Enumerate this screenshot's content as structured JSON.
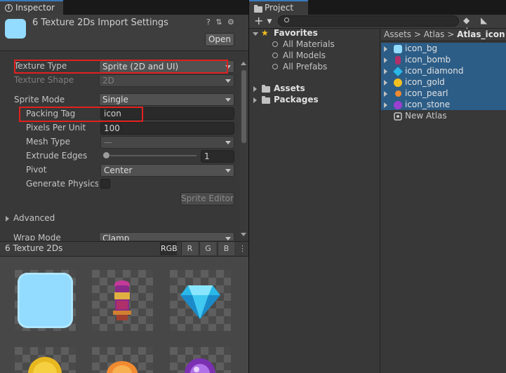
{
  "inspector": {
    "tab_label": "Inspector",
    "tab_tools": "⋮ ≡",
    "title": "6 Texture 2Ds Import Settings",
    "header_tools": "? ⇅ ⚙",
    "open_button": "Open",
    "fields": {
      "texture_type": {
        "label": "Texture Type",
        "value": "Sprite (2D and UI)"
      },
      "texture_shape": {
        "label": "Texture Shape",
        "value": "2D"
      },
      "sprite_mode": {
        "label": "Sprite Mode",
        "value": "Single"
      },
      "packing_tag": {
        "label": "Packing Tag",
        "value": "icon"
      },
      "pixels_per_unit": {
        "label": "Pixels Per Unit",
        "value": "100"
      },
      "mesh_type": {
        "label": "Mesh Type",
        "value": "—"
      },
      "extrude_edges": {
        "label": "Extrude Edges",
        "value": "1"
      },
      "pivot": {
        "label": "Pivot",
        "value": "Center"
      },
      "generate_physics": {
        "label": "Generate Physics S"
      }
    },
    "sprite_editor_button": "Sprite Editor",
    "advanced_label": "Advanced",
    "wrap_mode": {
      "label": "Wrap Mode",
      "value": "Clamp"
    },
    "preview": {
      "title": "6 Texture 2Ds",
      "channels": [
        "RGB",
        "R",
        "G",
        "B"
      ]
    }
  },
  "project": {
    "tab_label": "Project",
    "add_button": "+",
    "tool_icons": "◆ ◣ ★",
    "favorites": {
      "label": "Favorites",
      "items": [
        "All Materials",
        "All Models",
        "All Prefabs"
      ]
    },
    "roots": [
      "Assets",
      "Packages"
    ],
    "breadcrumb": {
      "parts": [
        "Assets",
        "Atlas"
      ],
      "separator": ">",
      "current": "Atlas_icon"
    },
    "files": [
      {
        "name": "icon_bg",
        "color": "#93dbff"
      },
      {
        "name": "icon_bomb",
        "color": "#b0306a"
      },
      {
        "name": "icon_diamond",
        "color": "#2ab8e8"
      },
      {
        "name": "icon_gold",
        "color": "#f0c020"
      },
      {
        "name": "icon_pearl",
        "color": "#f08a30"
      },
      {
        "name": "icon_stone",
        "color": "#9a40d0"
      }
    ],
    "atlas_file": "New Atlas"
  },
  "colors": {
    "selection": "#2c5d87",
    "highlight_box": "#e02020",
    "tab_accent": "#3a79bb"
  }
}
